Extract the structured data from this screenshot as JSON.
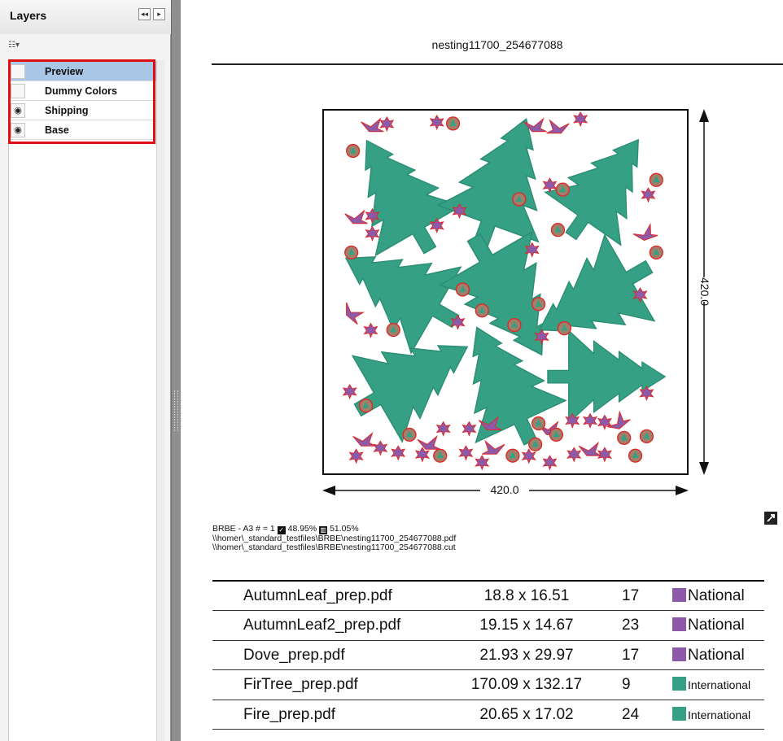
{
  "layers_panel": {
    "title": "Layers",
    "collapse_icon": "double-chevron-left-icon",
    "expand_icon": "chevron-right-icon",
    "menu_icon": "layer-options-icon",
    "layers": [
      {
        "name": "Preview",
        "visible": false,
        "selected": true
      },
      {
        "name": "Dummy Colors",
        "visible": false,
        "selected": false
      },
      {
        "name": "Shipping",
        "visible": true,
        "selected": false
      },
      {
        "name": "Base",
        "visible": true,
        "selected": false
      }
    ],
    "highlight_color": "#e01010"
  },
  "document": {
    "title": "nesting11700_254677088",
    "dimensions": {
      "width_label": "420.0",
      "height_label": "420.0"
    },
    "info": {
      "sheet_label": "BRBE - A3 # = 1",
      "used_percent": "48.95%",
      "waste_percent": "51.05%",
      "pdf_path": "\\\\homer\\_standard_testfiles\\BRBE\\nesting11700_254677088.pdf",
      "cut_path": "\\\\homer\\_standard_testfiles\\BRBE\\nesting11700_254677088.cut"
    },
    "parts": [
      {
        "file": "AutumnLeaf_prep.pdf",
        "size": "18.8 x 16.51",
        "qty": "17",
        "category": "National",
        "color": "#8c5aa8"
      },
      {
        "file": "AutumnLeaf2_prep.pdf",
        "size": "19.15 x 14.67",
        "qty": "23",
        "category": "National",
        "color": "#8c5aa8"
      },
      {
        "file": "Dove_prep.pdf",
        "size": "21.93 x 29.97",
        "qty": "17",
        "category": "National",
        "color": "#8c5aa8"
      },
      {
        "file": "FirTree_prep.pdf",
        "size": "170.09 x 132.17",
        "qty": "9",
        "category": "International",
        "color": "#35a084"
      },
      {
        "file": "Fire_prep.pdf",
        "size": "20.65 x 17.02",
        "qty": "24",
        "category": "International",
        "color": "#35a084"
      }
    ],
    "colors": {
      "tree": "#35a084",
      "leaf": "#8c5aa8",
      "outline": "#e02828",
      "fire_fill": "#a0806a"
    }
  }
}
